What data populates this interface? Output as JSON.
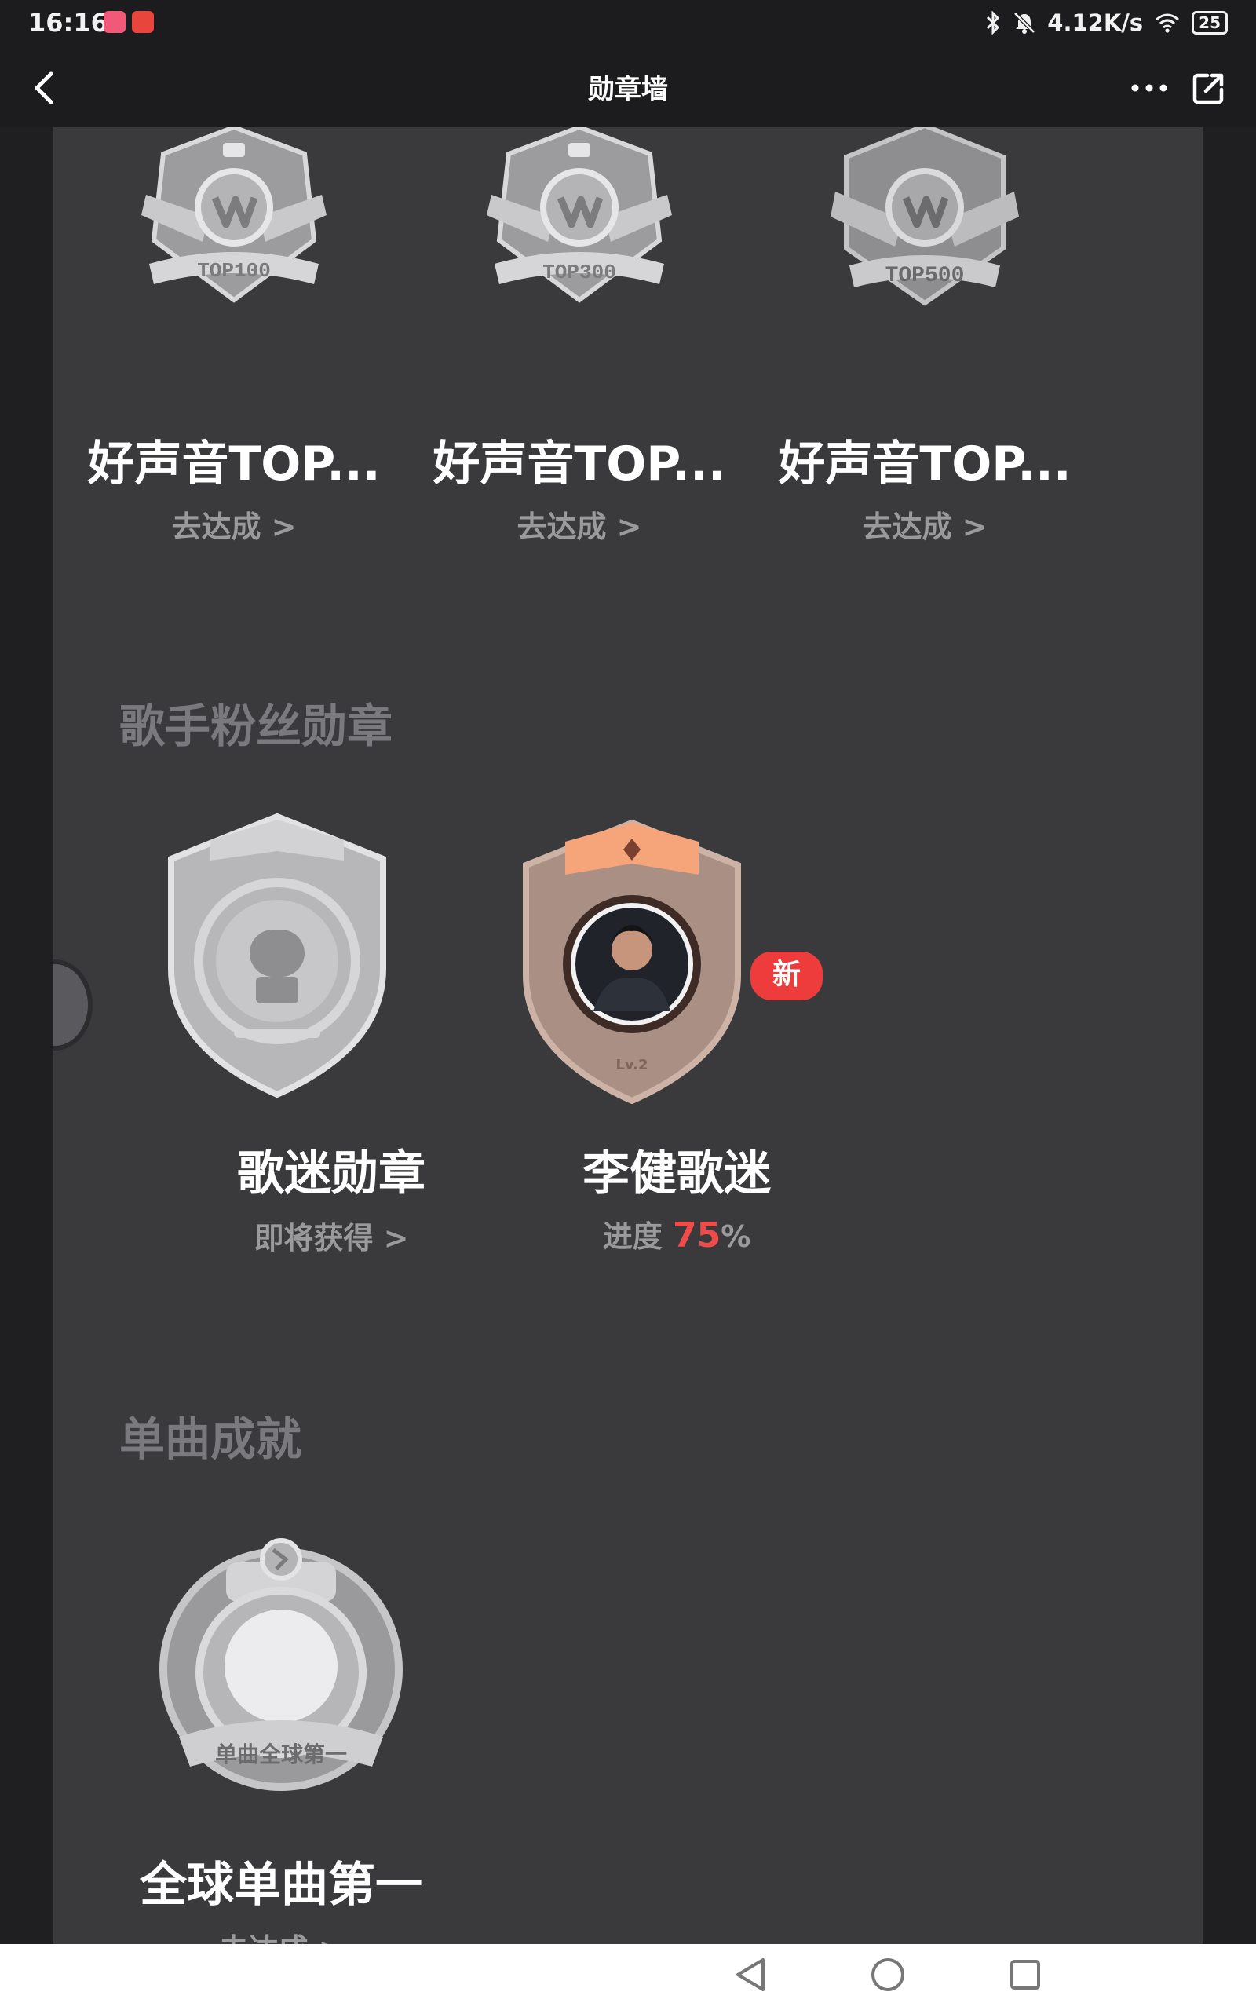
{
  "status_bar": {
    "time": "16:16",
    "network_speed": "4.12K/s",
    "battery": "25",
    "icons": [
      "bluetooth-icon",
      "mute-icon",
      "wifi-icon",
      "battery-icon"
    ]
  },
  "header": {
    "title": "勋章墙",
    "back_icon": "chevron-left-icon",
    "more_icon": "more-icon",
    "share_icon": "share-icon"
  },
  "top_badges": [
    {
      "emblem": "TOP100",
      "title": "好声音TOP...",
      "action": "去达成 >"
    },
    {
      "emblem": "TOP300",
      "title": "好声音TOP...",
      "action": "去达成 >"
    },
    {
      "emblem": "TOP500",
      "title": "好声音TOP...",
      "action": "去达成 >"
    }
  ],
  "fan_section": {
    "title": "歌手粉丝勋章",
    "badges": [
      {
        "title": "歌迷勋章",
        "action": "即将获得 >"
      },
      {
        "title": "李健歌迷",
        "progress_label": "进度",
        "progress_value": "75",
        "progress_unit": "%",
        "new_tag": "新",
        "level": "Lv.2"
      }
    ]
  },
  "single_section": {
    "title": "单曲成就",
    "badges": [
      {
        "emblem": "单曲全球第一",
        "title": "全球单曲第一",
        "action": "去达成 >"
      }
    ]
  },
  "colors": {
    "background": "#1f1f21",
    "panel": "#3a3a3c",
    "accent": "#f04b4b",
    "muted_text": "#9a9a9c",
    "section_title": "#7a7a7e"
  }
}
